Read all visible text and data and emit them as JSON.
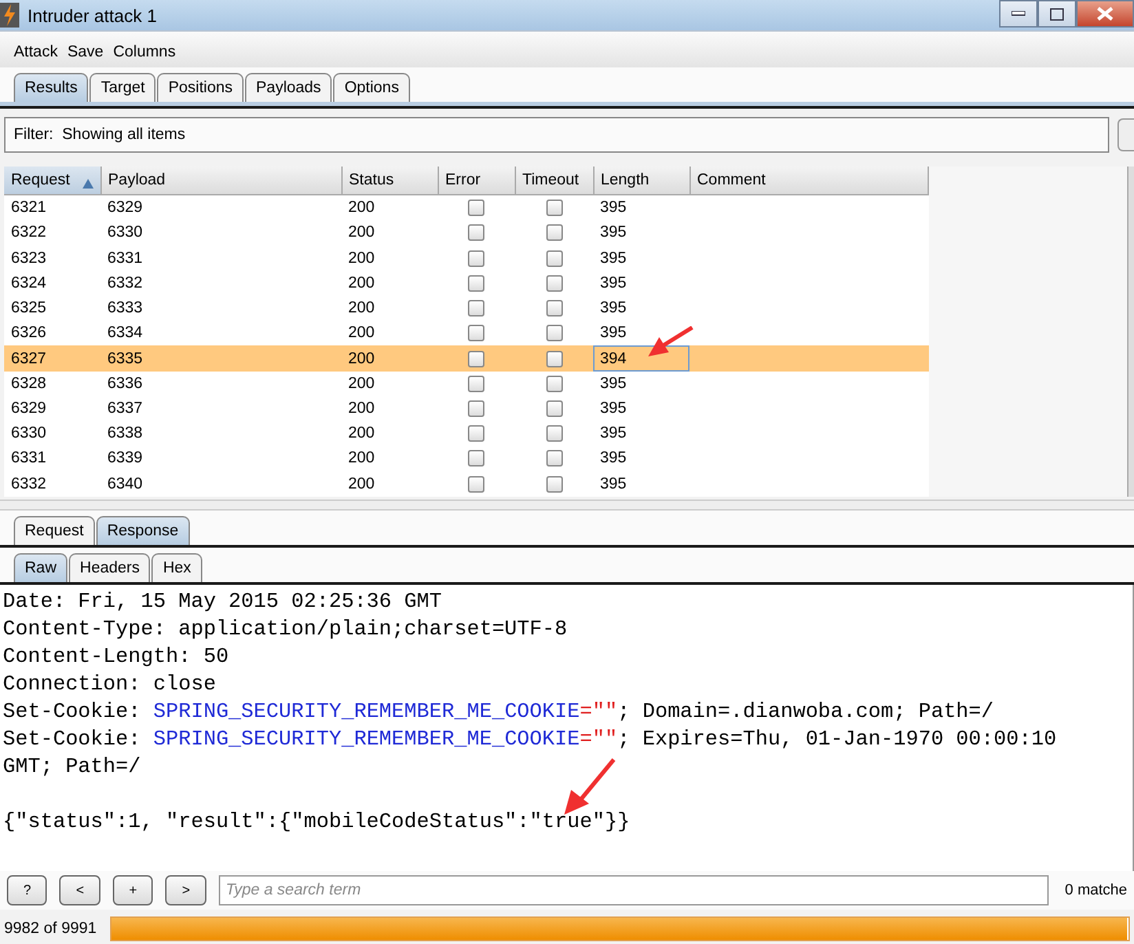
{
  "window": {
    "title": "Intruder attack 1"
  },
  "menu": [
    "Attack",
    "Save",
    "Columns"
  ],
  "tabs": [
    {
      "label": "Results",
      "selected": true
    },
    {
      "label": "Target",
      "selected": false
    },
    {
      "label": "Positions",
      "selected": false
    },
    {
      "label": "Payloads",
      "selected": false
    },
    {
      "label": "Options",
      "selected": false
    }
  ],
  "filter": {
    "label": "Filter:",
    "value": "Showing all items"
  },
  "table": {
    "columns": [
      "Request",
      "Payload",
      "Status",
      "Error",
      "Timeout",
      "Length",
      "Comment"
    ],
    "rows": [
      {
        "request": "6321",
        "payload": "6329",
        "status": "200",
        "error": false,
        "timeout": false,
        "length": "395",
        "selected": false
      },
      {
        "request": "6322",
        "payload": "6330",
        "status": "200",
        "error": false,
        "timeout": false,
        "length": "395",
        "selected": false
      },
      {
        "request": "6323",
        "payload": "6331",
        "status": "200",
        "error": false,
        "timeout": false,
        "length": "395",
        "selected": false
      },
      {
        "request": "6324",
        "payload": "6332",
        "status": "200",
        "error": false,
        "timeout": false,
        "length": "395",
        "selected": false
      },
      {
        "request": "6325",
        "payload": "6333",
        "status": "200",
        "error": false,
        "timeout": false,
        "length": "395",
        "selected": false
      },
      {
        "request": "6326",
        "payload": "6334",
        "status": "200",
        "error": false,
        "timeout": false,
        "length": "395",
        "selected": false
      },
      {
        "request": "6327",
        "payload": "6335",
        "status": "200",
        "error": false,
        "timeout": false,
        "length": "394",
        "selected": true
      },
      {
        "request": "6328",
        "payload": "6336",
        "status": "200",
        "error": false,
        "timeout": false,
        "length": "395",
        "selected": false
      },
      {
        "request": "6329",
        "payload": "6337",
        "status": "200",
        "error": false,
        "timeout": false,
        "length": "395",
        "selected": false
      },
      {
        "request": "6330",
        "payload": "6338",
        "status": "200",
        "error": false,
        "timeout": false,
        "length": "395",
        "selected": false
      },
      {
        "request": "6331",
        "payload": "6339",
        "status": "200",
        "error": false,
        "timeout": false,
        "length": "395",
        "selected": false
      },
      {
        "request": "6332",
        "payload": "6340",
        "status": "200",
        "error": false,
        "timeout": false,
        "length": "395",
        "selected": false
      }
    ]
  },
  "message_tabs": [
    {
      "label": "Request",
      "selected": false
    },
    {
      "label": "Response",
      "selected": true
    }
  ],
  "view_tabs": [
    {
      "label": "Raw",
      "selected": true
    },
    {
      "label": "Headers",
      "selected": false
    },
    {
      "label": "Hex",
      "selected": false
    }
  ],
  "response_lines": [
    [
      {
        "kind": "plain",
        "text": "Date: Fri, 15 May 2015 02:25:36 GMT"
      }
    ],
    [
      {
        "kind": "plain",
        "text": "Content-Type: application/plain;charset=UTF-8"
      }
    ],
    [
      {
        "kind": "plain",
        "text": "Content-Length: 50"
      }
    ],
    [
      {
        "kind": "plain",
        "text": "Connection: close"
      }
    ],
    [
      {
        "kind": "plain",
        "text": "Set-Cookie: "
      },
      {
        "kind": "name",
        "text": "SPRING_SECURITY_REMEMBER_ME_COOKIE"
      },
      {
        "kind": "value",
        "text": "=\"\""
      },
      {
        "kind": "plain",
        "text": "; Domain=.dianwoba.com; Path=/"
      }
    ],
    [
      {
        "kind": "plain",
        "text": "Set-Cookie: "
      },
      {
        "kind": "name",
        "text": "SPRING_SECURITY_REMEMBER_ME_COOKIE"
      },
      {
        "kind": "value",
        "text": "=\"\""
      },
      {
        "kind": "plain",
        "text": "; Expires=Thu, 01-Jan-1970 00:00:10"
      }
    ],
    [
      {
        "kind": "plain",
        "text": "GMT; Path=/"
      }
    ]
  ],
  "response_body": "{\"status\":1, \"result\":{\"mobileCodeStatus\":\"true\"}}",
  "search_buttons": [
    "?",
    "<",
    "+",
    ">"
  ],
  "search": {
    "placeholder": "Type a search term",
    "matches": "0 matche"
  },
  "progress": {
    "text": "9982 of 9991",
    "level": 0.999
  }
}
